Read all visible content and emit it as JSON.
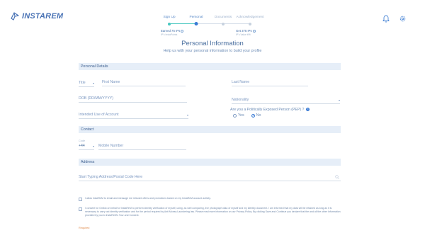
{
  "app": {
    "brand": "INSTAREM"
  },
  "steps": [
    {
      "label": "Sign Up",
      "state": "done"
    },
    {
      "label": "Personal",
      "state": "active"
    },
    {
      "label": "Documents",
      "state": "inactive"
    },
    {
      "label": "Acknowledgement",
      "state": "inactive"
    }
  ],
  "rewards": {
    "earned": {
      "title": "Earned 75 IPs",
      "sub": "IP's InstaPoints"
    },
    "get": {
      "title": "Get 375 IPs",
      "sub": "IP's Value ¥/ft"
    }
  },
  "page": {
    "title": "Personal Information",
    "subtitle": "Help us with your personal information to build your profile"
  },
  "sections": {
    "personal": "Personal Details",
    "contact": "Contact",
    "address": "Address"
  },
  "fields": {
    "title": "Title",
    "first_name": "First Name",
    "last_name": "Last Name",
    "dob": "DOB (DD/MM/YYYY)",
    "nationality": "Nationality",
    "intended_use": "Intended Use of Account",
    "pep_question": "Are you a Politically Exposed Person (PEP) ?",
    "pep_yes": "Yes",
    "pep_no": "No",
    "code_label": "Code",
    "code_value": "+44",
    "mobile": "Mobile Number",
    "address": "Start Typing Address/Postal Code Here"
  },
  "consents": {
    "marketing": "I allow InstaReM to email and message me relevant offers and promotions based on my InstaReM account activity.",
    "verification": "I consent for Onfido on behalf of InstaReM to perform identity verification of myself, using, as well comparing, live photograph data of myself and my identity document. I am informed that my data will be retained as long as it is necessary to carry out identity verification and for the period required by Anti Money Laundering law. Please read more information on our Privacy Policy. By clicking Save and Continue you declare that the and all the other Information provided by you to InstaReM's Tour and Consent."
  },
  "required": "Required",
  "colors": {
    "accent": "#3a7bd5",
    "step_done": "#46c7c0",
    "section_bg": "#e6eef8",
    "required": "#e08a4c"
  }
}
